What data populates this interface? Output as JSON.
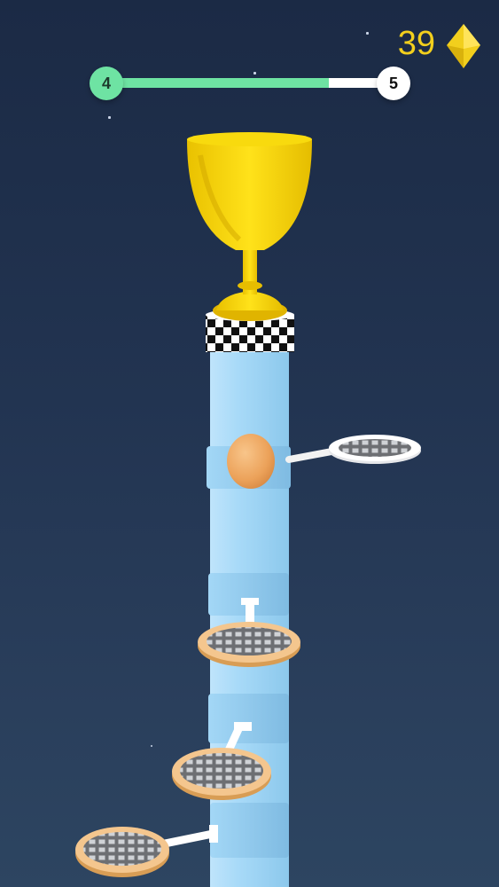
{
  "hud": {
    "level_current": "4",
    "level_next": "5",
    "level_progress": 0.8,
    "gem_count": "39"
  },
  "icons": {
    "gem": "yellow-diamond-gem-icon",
    "trophy": "gold-trophy-cup-icon"
  },
  "colors": {
    "progress": "#6ee3a3",
    "gem": "#f2cf1d",
    "tower": "#9fd4f5",
    "trophy": "#f5d20f",
    "ball": "#f0a85a"
  }
}
